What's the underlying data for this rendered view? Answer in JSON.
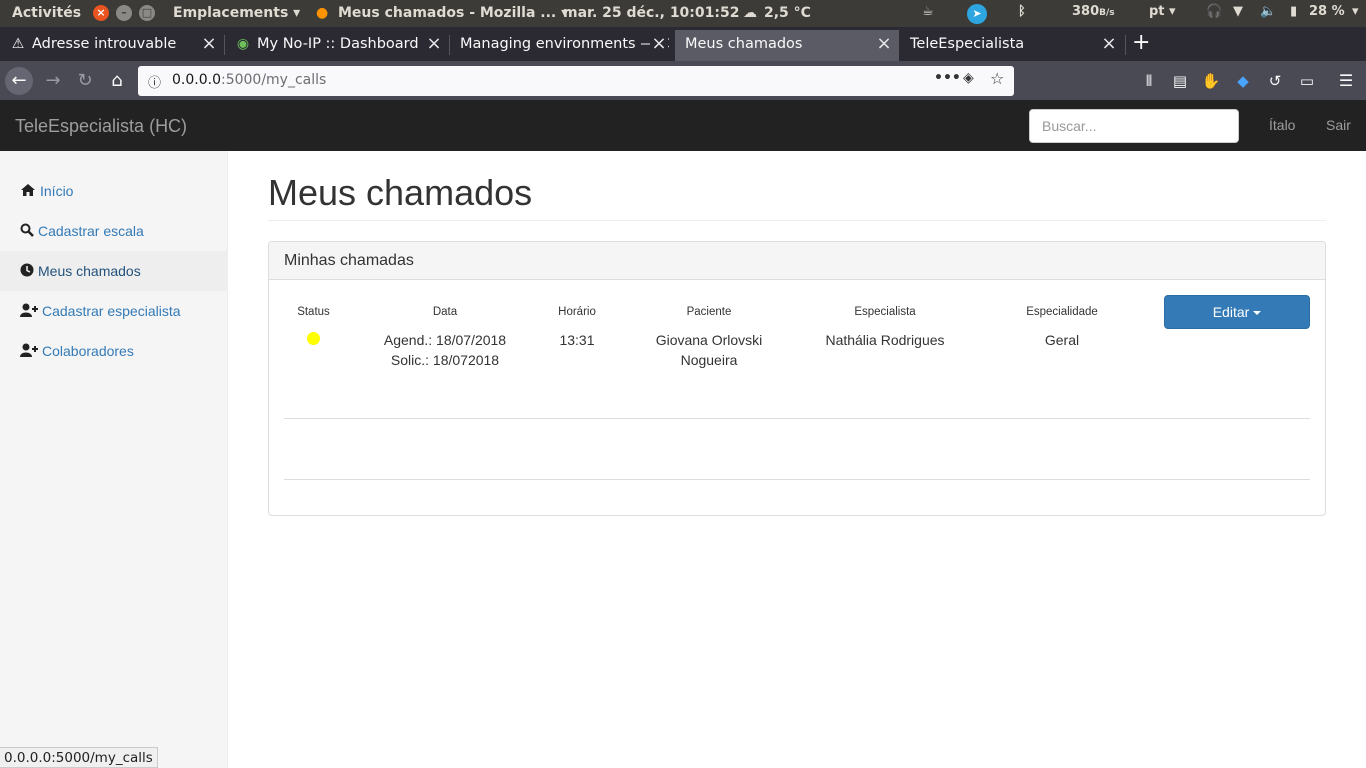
{
  "system_bar": {
    "activities": "Activités",
    "places": "Emplacements",
    "app_title": "Meus chamados - Mozilla ...",
    "clock": "mar. 25 déc., 10:01:52",
    "weather": "2,5 °C",
    "net_speed": "380",
    "net_unit": "B/s",
    "lang": "pt",
    "battery": "28 %"
  },
  "tabs": [
    {
      "label": "Adresse introuvable",
      "icon": "warning-icon"
    },
    {
      "label": "My No-IP :: Dashboard",
      "icon": "noip-icon"
    },
    {
      "label": "Managing environments — C",
      "icon": ""
    },
    {
      "label": "Meus chamados",
      "icon": "",
      "active": true
    },
    {
      "label": "TeleEspecialista",
      "icon": ""
    }
  ],
  "urlbar": {
    "host": "0.0.0.0",
    "path": ":5000/my_calls"
  },
  "app": {
    "brand": "TeleEspecialista (HC)",
    "search_placeholder": "Buscar...",
    "user": "Ítalo",
    "logout": "Sair"
  },
  "sidebar": {
    "items": [
      {
        "label": "Início",
        "icon": "home-icon"
      },
      {
        "label": "Cadastrar escala",
        "icon": "search-icon"
      },
      {
        "label": "Meus chamados",
        "icon": "clock-icon",
        "active": true
      },
      {
        "label": "Cadastrar especialista",
        "icon": "user-add-icon"
      },
      {
        "label": "Colaboradores",
        "icon": "user-add-icon"
      }
    ]
  },
  "main": {
    "title": "Meus chamados",
    "panel_title": "Minhas chamadas",
    "columns": [
      "Status",
      "Data",
      "Horário",
      "Paciente",
      "Especialista",
      "Especialidade"
    ],
    "rows": [
      {
        "status_color": "#ffff00",
        "data_agend": "Agend.: 18/07/2018",
        "data_solic": "Solic.: 18/072018",
        "horario": "13:31",
        "paciente_1": "Giovana Orlovski",
        "paciente_2": "Nogueira",
        "especialista": "Nathália Rodrigues",
        "especialidade": "Geral"
      }
    ],
    "edit_label": "Editar"
  },
  "statusbar": {
    "url": "0.0.0.0:5000/my_calls"
  },
  "colors": {
    "accent": "#337ab7",
    "navbar": "#222222",
    "status_yellow": "#ffff00"
  }
}
